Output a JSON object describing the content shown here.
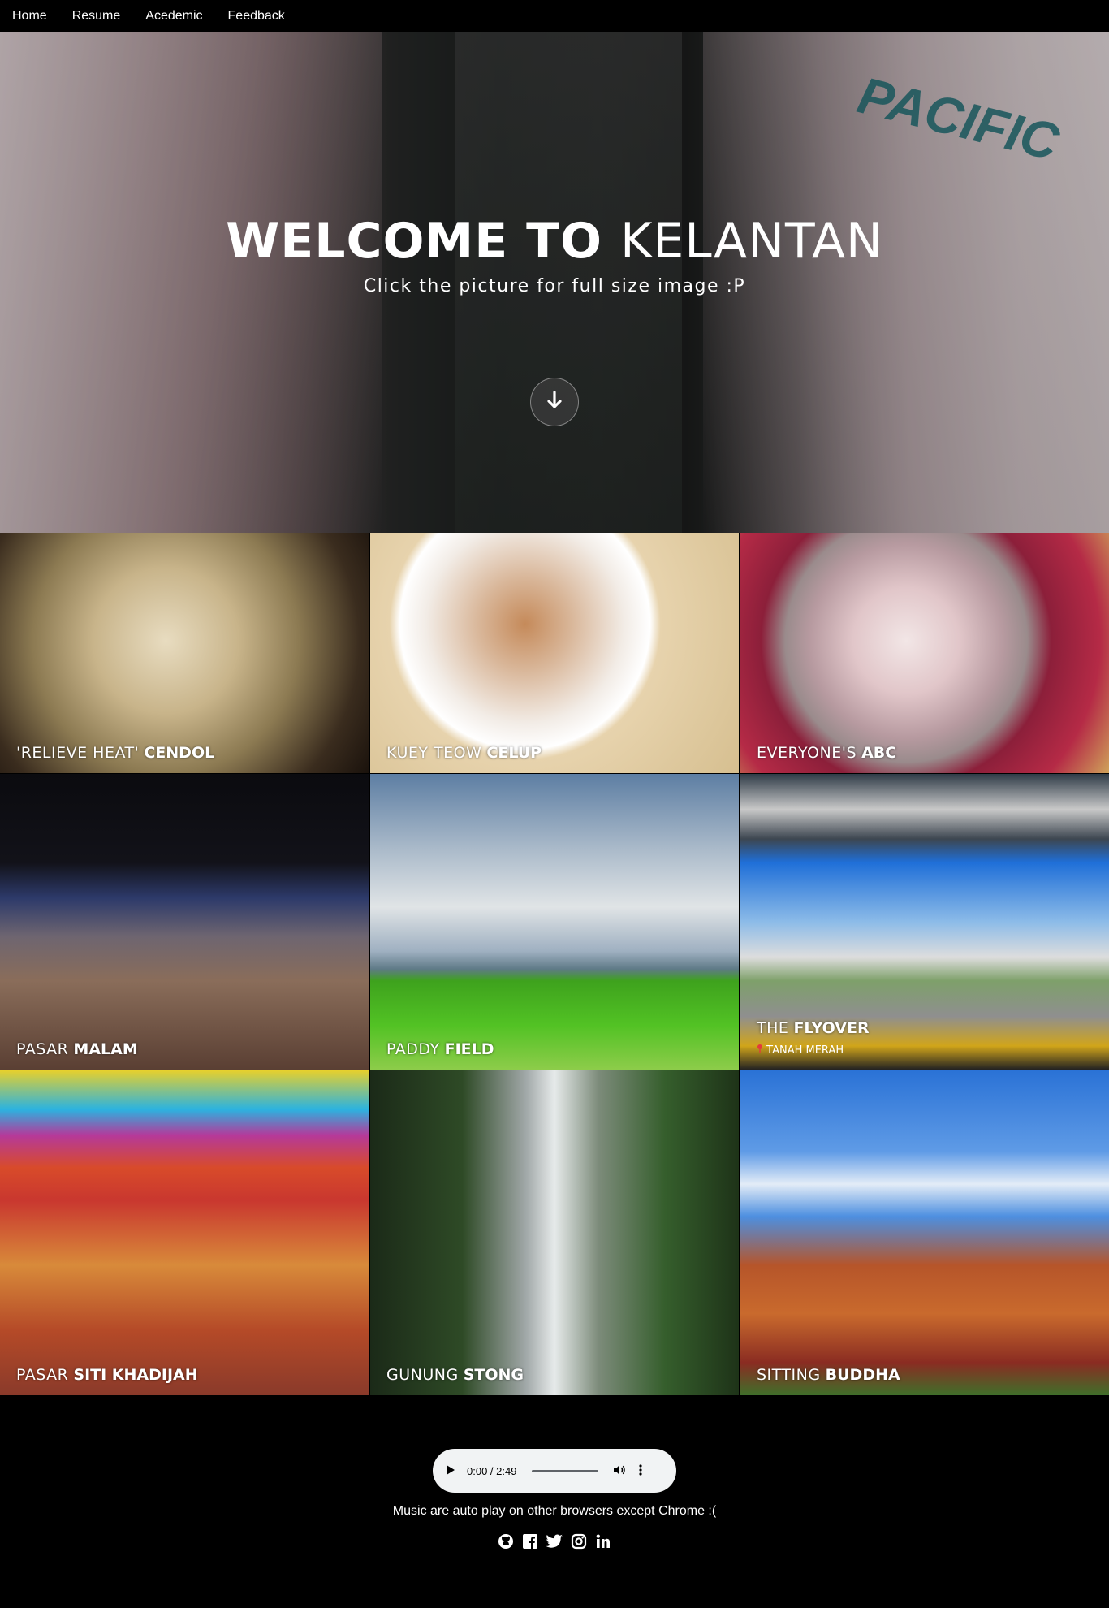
{
  "nav": {
    "items": [
      "Home",
      "Resume",
      "Acedemic",
      "Feedback"
    ]
  },
  "hero": {
    "title_bold": "WELCOME TO",
    "title_thin": "KELANTAN",
    "subtitle": "Click the picture for full size image :P",
    "sign_text": "PACIFIC",
    "down_icon": "arrow-down-icon"
  },
  "gallery": {
    "tiles": [
      {
        "light": "'RELIEVE HEAT'",
        "strong": "CENDOL",
        "location": ""
      },
      {
        "light": "KUEY TEOW",
        "strong": "CELUP",
        "location": ""
      },
      {
        "light": "EVERYONE'S",
        "strong": "ABC",
        "location": ""
      },
      {
        "light": "PASAR",
        "strong": "MALAM",
        "location": ""
      },
      {
        "light": "PADDY",
        "strong": "FIELD",
        "location": ""
      },
      {
        "light": "THE",
        "strong": "FLYOVER",
        "location": "TANAH MERAH"
      },
      {
        "light": "PASAR",
        "strong": "SITI KHADIJAH",
        "location": ""
      },
      {
        "light": "GUNUNG",
        "strong": "STONG",
        "location": ""
      },
      {
        "light": "SITTING",
        "strong": "BUDDHA",
        "location": ""
      }
    ]
  },
  "footer": {
    "audio_time": "0:00 / 2:49",
    "note": "Music are auto play on other browsers except Chrome :(",
    "social_icons": [
      "github-icon",
      "facebook-icon",
      "twitter-icon",
      "instagram-icon",
      "linkedin-icon"
    ]
  }
}
